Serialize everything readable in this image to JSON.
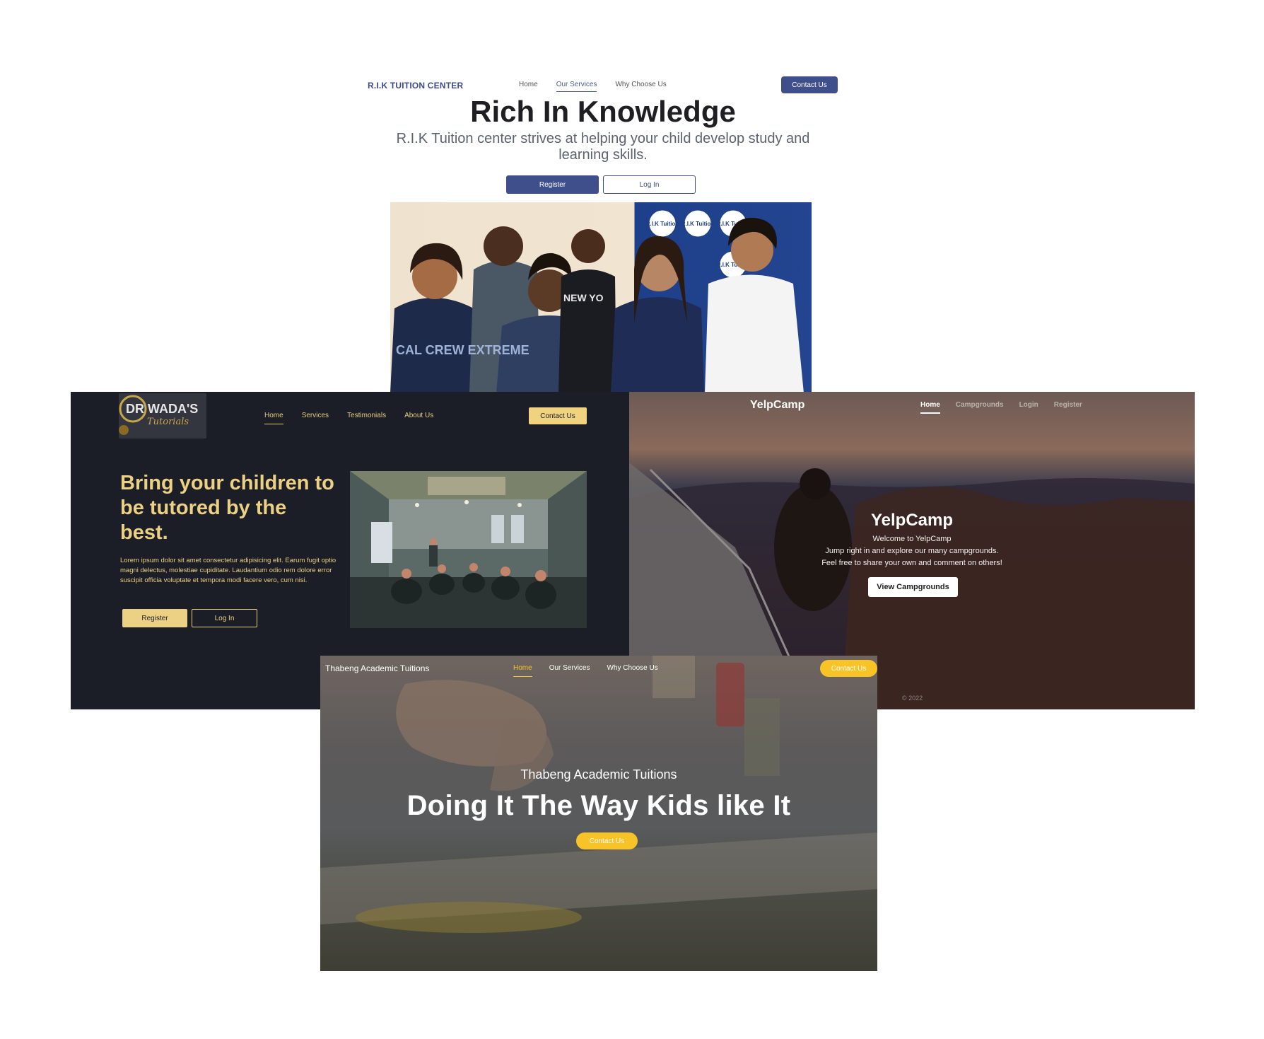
{
  "rik": {
    "brand": "R.I.K TUITION CENTER",
    "nav": [
      "Home",
      "Our Services",
      "Why Choose Us"
    ],
    "nav_active": "Our Services",
    "contact": "Contact Us",
    "title": "Rich In Knowledge",
    "subtitle": "R.I.K Tuition center strives at helping your child develop study and learning skills.",
    "register": "Register",
    "login": "Log In",
    "banner_badge": "R.I.K Tuition",
    "shirt_text": "NEW YO",
    "hoodie_text": "CAL CREW EXTREME"
  },
  "wada": {
    "logo_text": "DR WADA'S",
    "logo_script": "Tutorials",
    "nav": [
      "Home",
      "Services",
      "Testimonials",
      "About Us"
    ],
    "contact": "Contact Us",
    "headline": "Bring your children to be tutored by the best.",
    "body": "Lorem ipsum dolor sit amet consectetur adipisicing elit. Earum fugit optio magni delectus, molestiae cupiditate. Laudantium odio rem dolore error suscipit officia voluptate et tempora modi facere vero, cum nisi.",
    "register": "Register",
    "login": "Log In"
  },
  "yelp": {
    "brand": "YelpCamp",
    "nav": [
      "Home",
      "Campgrounds",
      "Login",
      "Register"
    ],
    "title": "YelpCamp",
    "lines": [
      "Welcome to YelpCamp",
      "Jump right in and explore our many campgrounds.",
      "Feel free to share your own and comment on others!"
    ],
    "button": "View Campgrounds",
    "footer": "© 2022"
  },
  "thabeng": {
    "brand": "Thabeng Academic Tuitions",
    "nav": [
      "Home",
      "Our Services",
      "Why Choose Us"
    ],
    "contact": "Contact Us",
    "subtitle": "Thabeng Academic Tuitions",
    "title": "Doing It The Way Kids like It",
    "button": "Contact Us"
  }
}
